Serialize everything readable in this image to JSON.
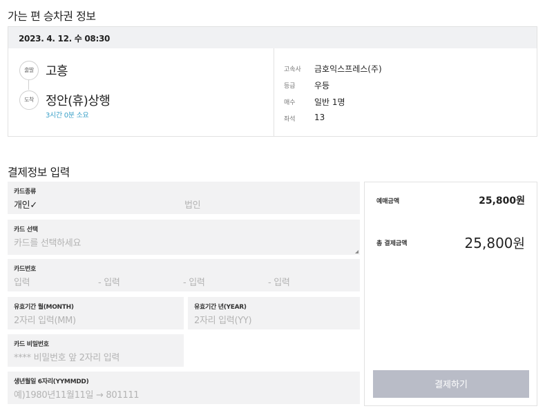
{
  "ticket_section": {
    "title": "가는 편 승차권 정보",
    "date_time": "2023. 4. 12. 수 08:30",
    "depart_badge": "출발",
    "depart": "고흥",
    "arrive_badge": "도착",
    "arrive": "정안(휴)상행",
    "duration": "3시간 0분 소요",
    "details": [
      {
        "label": "고속사",
        "value": "금호익스프레스(주)"
      },
      {
        "label": "등급",
        "value": "우등"
      },
      {
        "label": "매수",
        "value": "일반 1명"
      },
      {
        "label": "좌석",
        "value": "13"
      }
    ]
  },
  "payment_section": {
    "title": "결제정보 입력",
    "card_type": {
      "label": "카드종류",
      "personal": "개인✓",
      "corporate": "법인"
    },
    "card_select": {
      "label": "카드 선택",
      "placeholder": "카드를 선택하세요"
    },
    "card_number": {
      "label": "카드번호",
      "parts": [
        "입력",
        "- 입력",
        "- 입력",
        "- 입력"
      ]
    },
    "exp_month": {
      "label": "유효기간 월(MONTH)",
      "placeholder": "2자리 입력(MM)"
    },
    "exp_year": {
      "label": "유효기간 년(YEAR)",
      "placeholder": "2자리 입력(YY)"
    },
    "card_password": {
      "label": "카드 비밀번호",
      "placeholder": "**** 비밀번호 앞 2자리 입력"
    },
    "birth": {
      "label": "생년월일 6자리(YYMMDD)",
      "placeholder": "예)1980년11월11일 → 801111"
    }
  },
  "summary": {
    "booking_label": "예매금액",
    "booking_amount": "25,800원",
    "total_label": "총 결제금액",
    "total_amount": "25,800",
    "total_unit": "원",
    "pay_button": "결제하기"
  },
  "colors": {
    "duration": "#3aa0c7",
    "field_bg": "#f2f2f3",
    "pay_button_bg": "#b9bcc7"
  }
}
